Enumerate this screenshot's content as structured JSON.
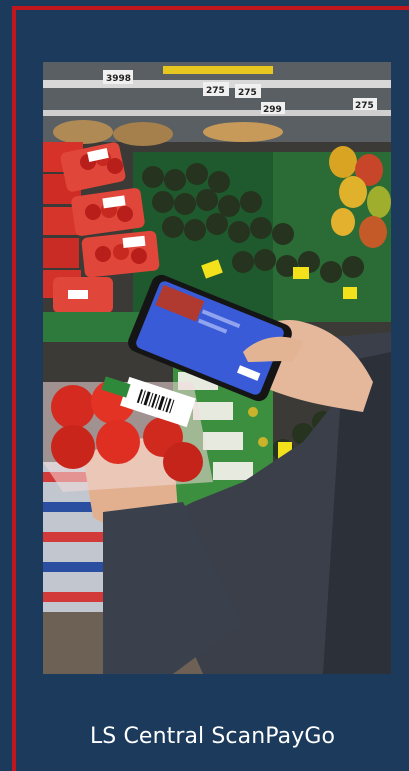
{
  "caption": "LS Central ScanPayGo",
  "photo_subject": "shopper-scanning-product-with-phone",
  "colors": {
    "background": "#1b3a5c",
    "frame_accent": "#c0161e",
    "caption_text": "#ffffff",
    "phone_screen": "#3a5bd8"
  },
  "shelf_tags": [
    "3998",
    "275",
    "275",
    "299",
    "275"
  ]
}
